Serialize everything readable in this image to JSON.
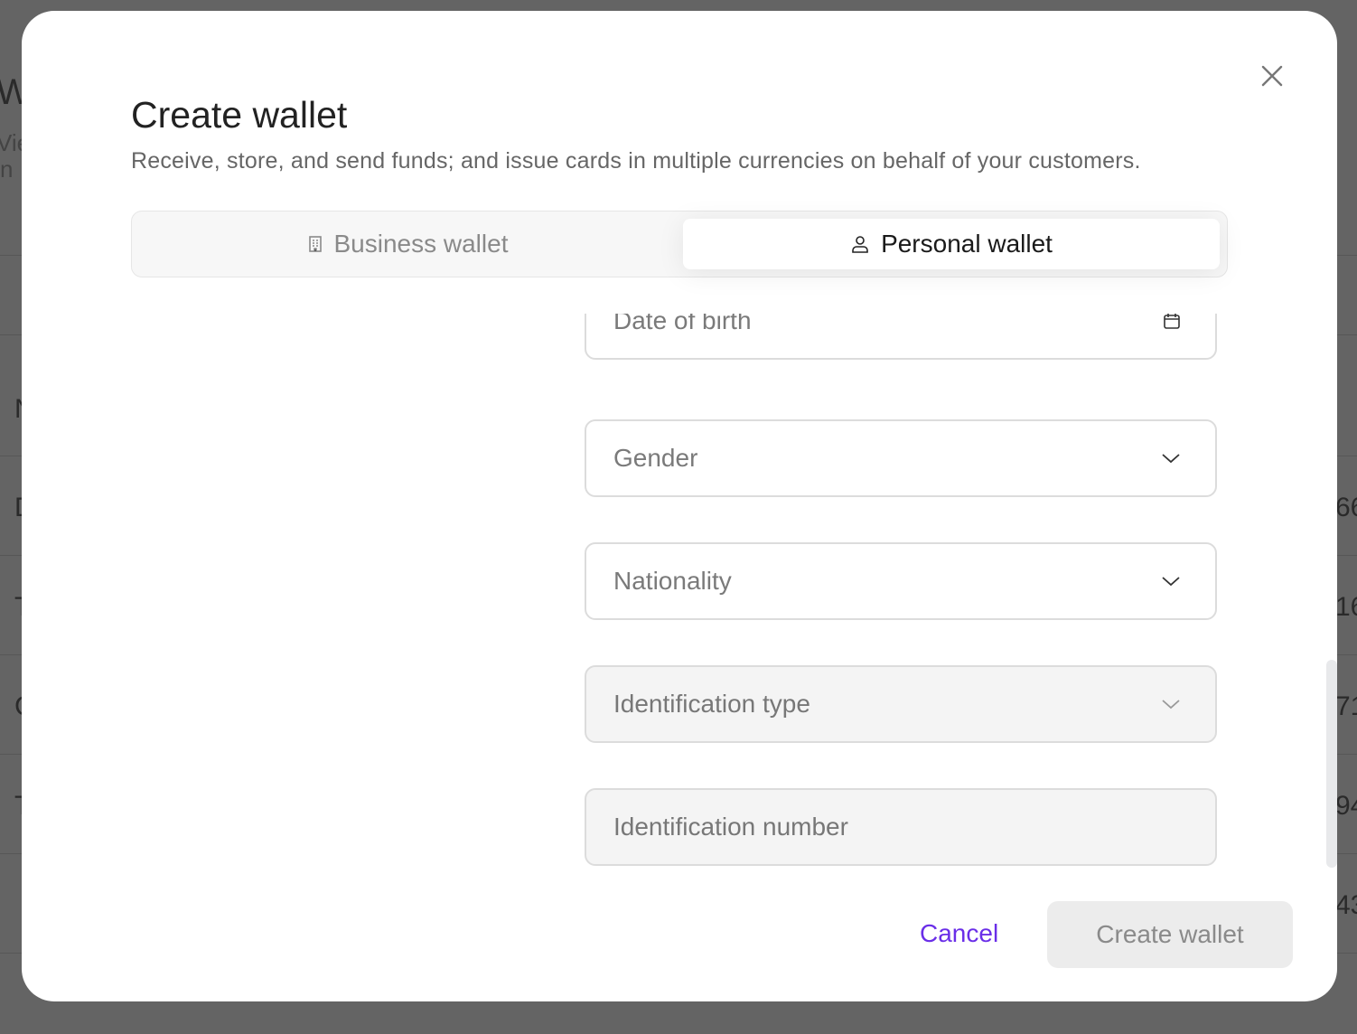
{
  "background": {
    "left_fragments": [
      "W",
      "Vie",
      "n",
      "N",
      "D",
      "T",
      "C",
      "T"
    ],
    "right_fragments": [
      "66",
      "16",
      "71",
      "94",
      "43"
    ]
  },
  "modal": {
    "title": "Create wallet",
    "subtitle": "Receive, store, and send funds; and issue cards in multiple currencies on behalf of your customers.",
    "tabs": [
      {
        "label": "Business wallet",
        "icon": "building-icon",
        "selected": false
      },
      {
        "label": "Personal wallet",
        "icon": "user-icon",
        "selected": true
      }
    ],
    "fields": [
      {
        "placeholder": "Date of birth",
        "icon": "calendar-icon",
        "disabled": false
      },
      {
        "placeholder": "Gender",
        "icon": "chevron-down-icon",
        "disabled": false
      },
      {
        "placeholder": "Nationality",
        "icon": "chevron-down-icon",
        "disabled": false
      },
      {
        "placeholder": "Identification type",
        "icon": "chevron-down-icon",
        "disabled": true
      },
      {
        "placeholder": "Identification number",
        "disabled": true
      }
    ],
    "cancel_label": "Cancel",
    "submit_label": "Create wallet",
    "colors": {
      "accent": "#6a2ee8",
      "overlay": "#646464"
    }
  }
}
